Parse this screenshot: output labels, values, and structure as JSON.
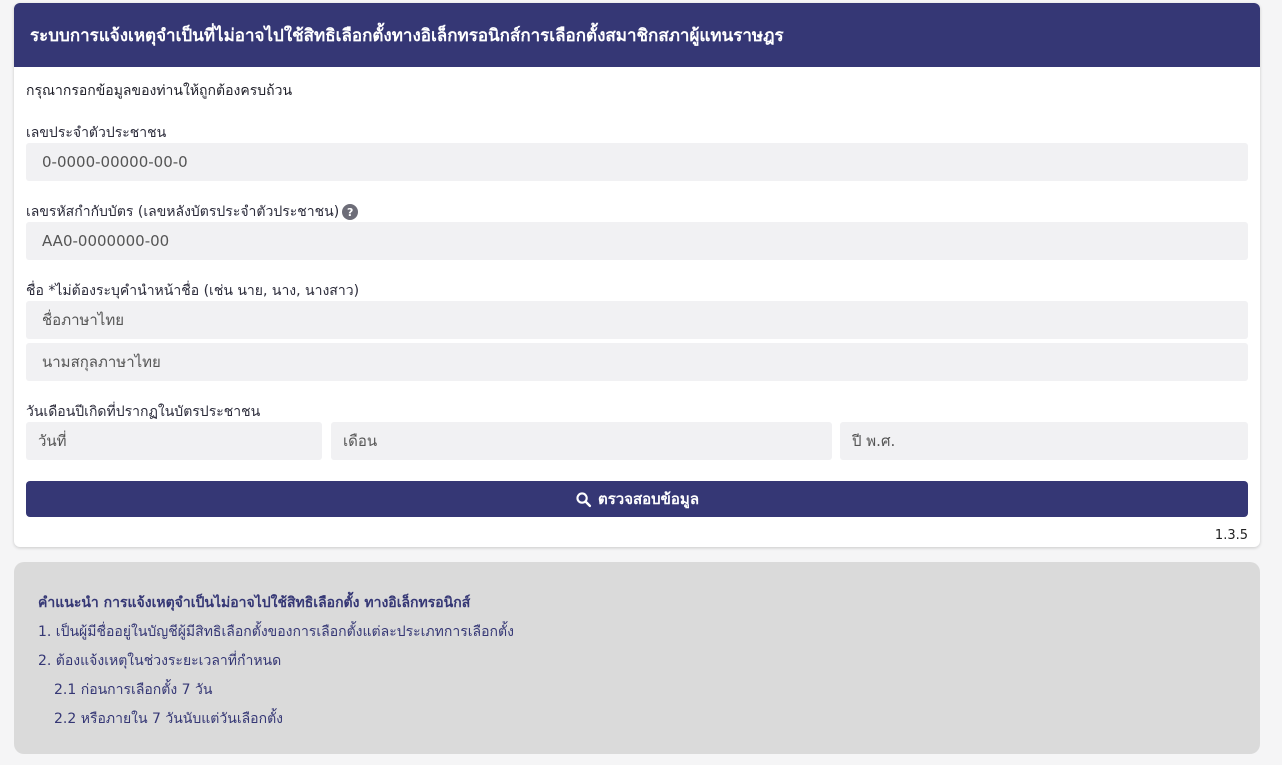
{
  "header": {
    "title": "ระบบการแจ้งเหตุจำเป็นที่ไม่อาจไปใช้สิทธิเลือกตั้งทางอิเล็กทรอนิกส์การเลือกตั้งสมาชิกสภาผู้แทนราษฎร"
  },
  "form": {
    "intro": "กรุณากรอกข้อมูลของท่านให้ถูกต้องครบถ้วน",
    "id_label": "เลขประจำตัวประชาชน",
    "id_placeholder": "0-0000-00000-00-0",
    "laser_label": "เลขรหัสกำกับบัตร (เลขหลังบัตรประจำตัวประชาชน)",
    "laser_help_icon": "question-circle-icon",
    "laser_placeholder": "AA0-0000000-00",
    "name_label": "ชื่อ *ไม่ต้องระบุคำนำหน้าชื่อ (เช่น นาย, นาง, นางสาว)",
    "first_name_placeholder": "ชื่อภาษาไทย",
    "last_name_placeholder": "นามสกุลภาษาไทย",
    "dob_label": "วันเดือนปีเกิดที่ปรากฏในบัตรประชาชน",
    "day_placeholder": "วันที่",
    "month_placeholder": "เดือน",
    "year_placeholder": "ปี พ.ศ.",
    "submit_label": "ตรวจสอบข้อมูล",
    "submit_icon": "search-icon",
    "version": "1.3.5"
  },
  "notes": {
    "title": "คำแนะนำ การแจ้งเหตุจำเป็นไม่อาจไปใช้สิทธิเลือกตั้ง ทางอิเล็กทรอนิกส์",
    "items": [
      "1. เป็นผู้มีชื่ออยู่ในบัญชีผู้มีสิทธิเลือกตั้งของการเลือกตั้งแต่ละประเภทการเลือกตั้ง",
      "2. ต้องแจ้งเหตุในช่วงระยะเวลาที่กำหนด",
      "2.1 ก่อนการเลือกตั้ง 7 วัน",
      "2.2 หรือภายใน 7 วันนับแต่วันเลือกตั้ง"
    ]
  },
  "colors": {
    "primary": "#353775",
    "field_bg": "#f1f1f3",
    "notes_bg": "#dadada",
    "page_bg": "#f5f5f6"
  }
}
